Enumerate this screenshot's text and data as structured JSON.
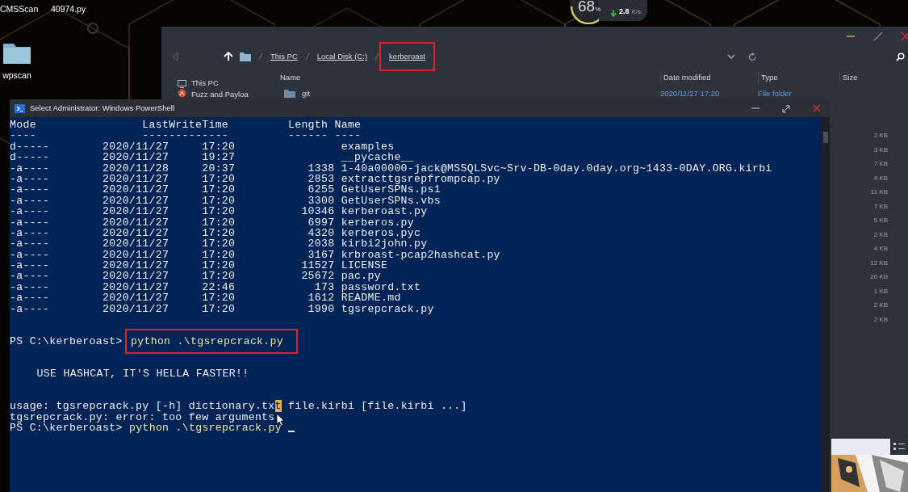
{
  "desktop": {
    "icons": [
      {
        "label": "CMSScan",
        "kind": "label"
      },
      {
        "label": "40974.py",
        "kind": "label"
      },
      {
        "label": "wpscan",
        "kind": "folder"
      }
    ]
  },
  "net_widget": {
    "percent": "68",
    "unit": "%",
    "speed": "2.8",
    "speed_unit": "K/s"
  },
  "explorer": {
    "breadcrumbs": [
      {
        "label": "This PC",
        "highlighted": false
      },
      {
        "label": "Local Disk (C:)",
        "highlighted": false
      },
      {
        "label": "kerberoast",
        "highlighted": true
      }
    ],
    "sidebar": [
      {
        "label": "This PC",
        "kind": "pc"
      },
      {
        "label": "Fuzz and Payloa",
        "kind": "app"
      }
    ],
    "columns": [
      "Name",
      "Date modified",
      "Type",
      "Size"
    ],
    "rows": [
      {
        "name": "git",
        "date": "2020/11/27 17:20",
        "type": "File folder"
      }
    ],
    "sizes": [
      "2 KB",
      "3 KB",
      "7 KB",
      "4 KB",
      "11 KB",
      "7 KB",
      "5 KB",
      "2 KB",
      "4 KB",
      "12 KB",
      "26 KB",
      "1 KB",
      "2 KB",
      "2 KB"
    ]
  },
  "console": {
    "title": "Select Administrator: Windows PowerShell",
    "lines": [
      {
        "kind": "text",
        "text": "Mode                LastWriteTime         Length Name"
      },
      {
        "kind": "text",
        "text": "----                -------------         ------ ----"
      },
      {
        "kind": "text",
        "text": "d-----        2020/11/27     17:20                examples"
      },
      {
        "kind": "text",
        "text": "d-----        2020/11/27     19:27                __pycache__"
      },
      {
        "kind": "text",
        "text": "-a----        2020/11/28     20:37           1338 1-40a00000-jack@MSSQLSvc~Srv-DB-0day.0day.org~1433-0DAY.ORG.kirbi"
      },
      {
        "kind": "text",
        "text": "-a----        2020/11/27     17:20           2853 extracttgsrepfrompcap.py"
      },
      {
        "kind": "text",
        "text": "-a----        2020/11/27     17:20           6255 GetUserSPNs.ps1"
      },
      {
        "kind": "text",
        "text": "-a----        2020/11/27     17:20           3300 GetUserSPNs.vbs"
      },
      {
        "kind": "text",
        "text": "-a----        2020/11/27     17:20          10346 kerberoast.py"
      },
      {
        "kind": "text",
        "text": "-a----        2020/11/27     17:20           6997 kerberos.py"
      },
      {
        "kind": "text",
        "text": "-a----        2020/11/27     17:20           4320 kerberos.pyc"
      },
      {
        "kind": "text",
        "text": "-a----        2020/11/27     17:20           2038 kirbi2john.py"
      },
      {
        "kind": "text",
        "text": "-a----        2020/11/27     17:20           3167 krbroast-pcap2hashcat.py"
      },
      {
        "kind": "text",
        "text": "-a----        2020/11/27     17:20          11527 LICENSE"
      },
      {
        "kind": "text",
        "text": "-a----        2020/11/27     17:20          25672 pac.py"
      },
      {
        "kind": "text",
        "text": "-a----        2020/11/27     22:46            173 password.txt"
      },
      {
        "kind": "text",
        "text": "-a----        2020/11/27     17:20           1612 README.md"
      },
      {
        "kind": "text",
        "text": "-a----        2020/11/27     17:20           1990 tgsrepcrack.py"
      },
      {
        "kind": "blank"
      },
      {
        "kind": "blank"
      },
      {
        "kind": "segments",
        "cursor": false,
        "segments": [
          {
            "text": "PS C:\\kerberoast>",
            "kind": "prompt",
            "highlighted": false
          },
          {
            "text": "python .\\tgsrepcrack.py",
            "kind": "command",
            "highlighted": true
          }
        ]
      },
      {
        "kind": "blank"
      },
      {
        "kind": "blank"
      },
      {
        "kind": "indented",
        "text": "USE HASHCAT, IT'S HELLA FASTER!!"
      },
      {
        "kind": "blank"
      },
      {
        "kind": "blank"
      },
      {
        "kind": "segments",
        "cursor": false,
        "segments": [
          {
            "text": "usage: tgsrepcrack.py [-h] dictionary.tx",
            "kind": "plain",
            "highlighted": false
          },
          {
            "text": "t",
            "kind": "selected",
            "highlighted": false
          },
          {
            "text": " file.kirbi [file.kirbi ...]",
            "kind": "plain",
            "highlighted": false
          }
        ]
      },
      {
        "kind": "text",
        "text": "tgsrepcrack.py: error: too few arguments"
      },
      {
        "kind": "segments",
        "cursor": true,
        "segments": [
          {
            "text": "PS C:\\kerberoast>",
            "kind": "prompt",
            "highlighted": false
          },
          {
            "text": "python .\\tgsrepcrack.py",
            "kind": "command",
            "highlighted": false
          }
        ]
      }
    ]
  }
}
